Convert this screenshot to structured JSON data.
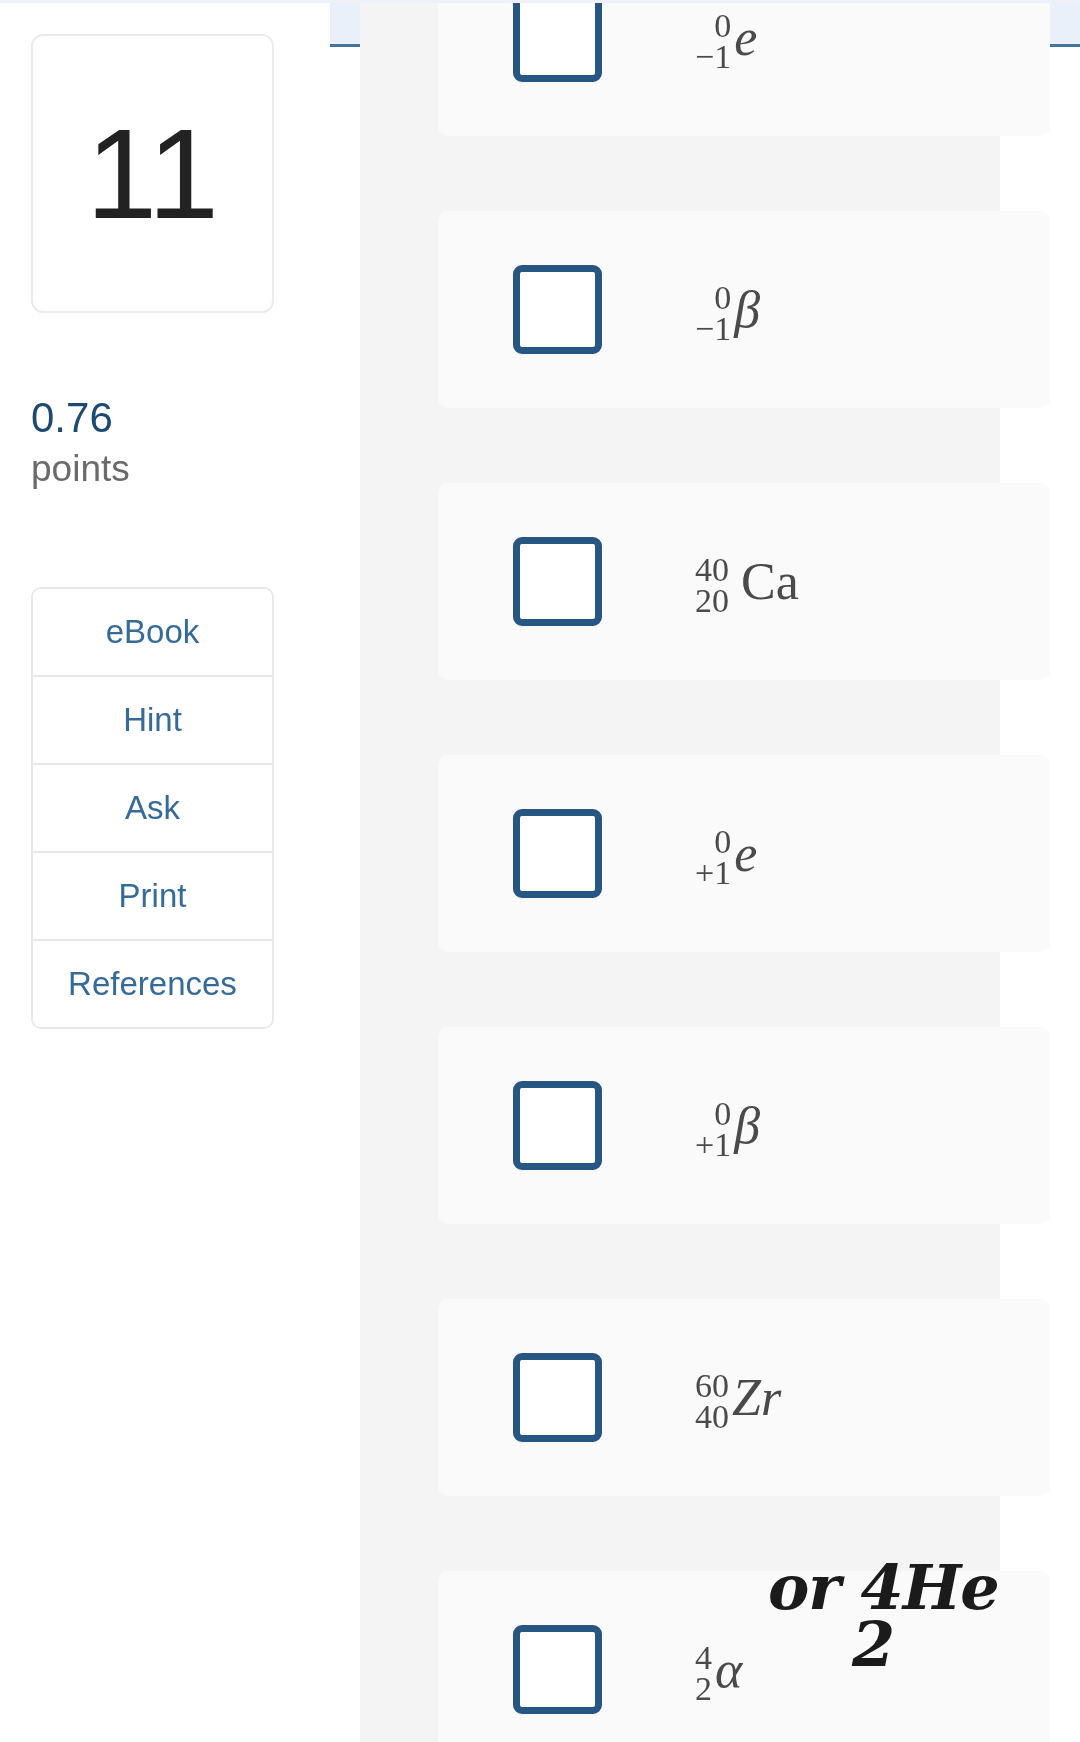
{
  "question": {
    "number": "11",
    "score": "0.76",
    "score_unit": "points"
  },
  "tools": [
    "eBook",
    "Hint",
    "Ask",
    "Print",
    "References"
  ],
  "options": [
    {
      "checked": false,
      "mass_number": "0",
      "atomic_number": "−1",
      "symbol": "e",
      "italic": true
    },
    {
      "checked": false,
      "mass_number": "0",
      "atomic_number": "−1",
      "symbol": "β",
      "italic": true
    },
    {
      "checked": false,
      "mass_number": "40",
      "atomic_number": "20",
      "symbol": "Ca",
      "italic": false
    },
    {
      "checked": false,
      "mass_number": "0",
      "atomic_number": "+1",
      "symbol": "e",
      "italic": true
    },
    {
      "checked": false,
      "mass_number": "0",
      "atomic_number": "+1",
      "symbol": "β",
      "italic": true
    },
    {
      "checked": false,
      "mass_number": "60",
      "atomic_number": "40",
      "symbol": "Zr",
      "italic": true
    },
    {
      "checked": false,
      "mass_number": "4",
      "atomic_number": "2",
      "symbol": "α",
      "italic": true
    }
  ],
  "annotation": {
    "text": "or 4He",
    "subscript": "2"
  }
}
